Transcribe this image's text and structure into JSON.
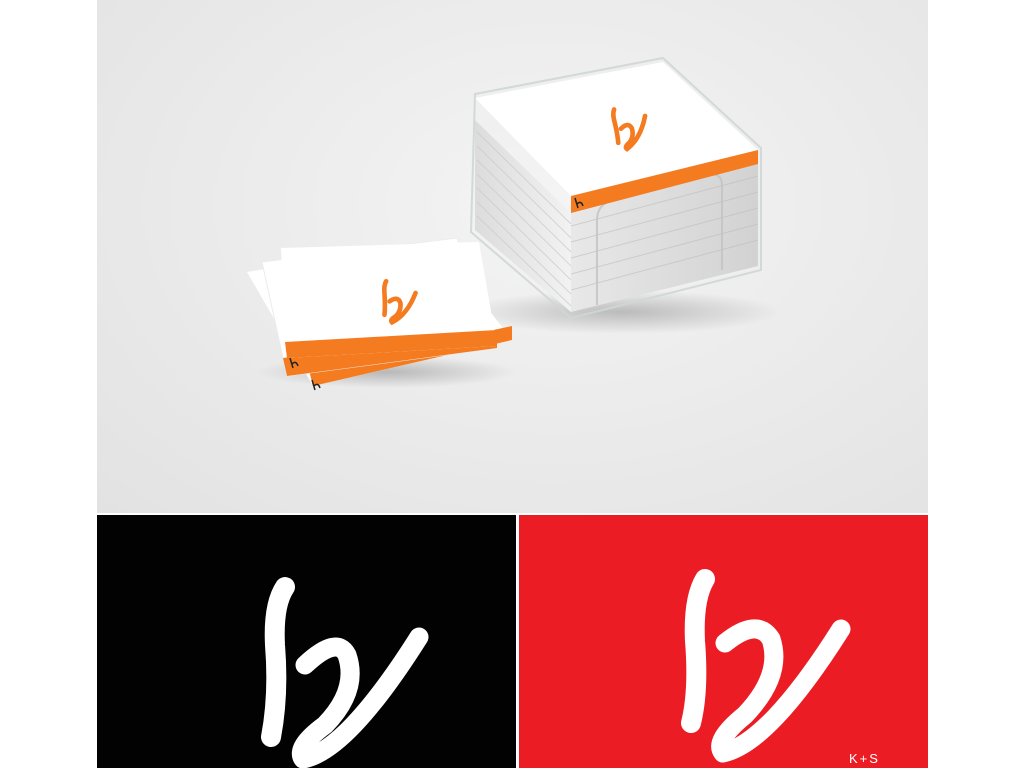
{
  "brand": {
    "logo_mark": "ky-logo-icon",
    "wordmark": "K+S"
  },
  "colors": {
    "accent_orange": "#f47b20",
    "panel_black": "#020202",
    "panel_red": "#ec1c24",
    "mockup_background": "#e9e9e9",
    "logo_light": "#ffffff"
  },
  "sections": [
    {
      "name": "memo-cube-mockup"
    },
    {
      "name": "logo-on-black"
    },
    {
      "name": "logo-on-red"
    }
  ]
}
